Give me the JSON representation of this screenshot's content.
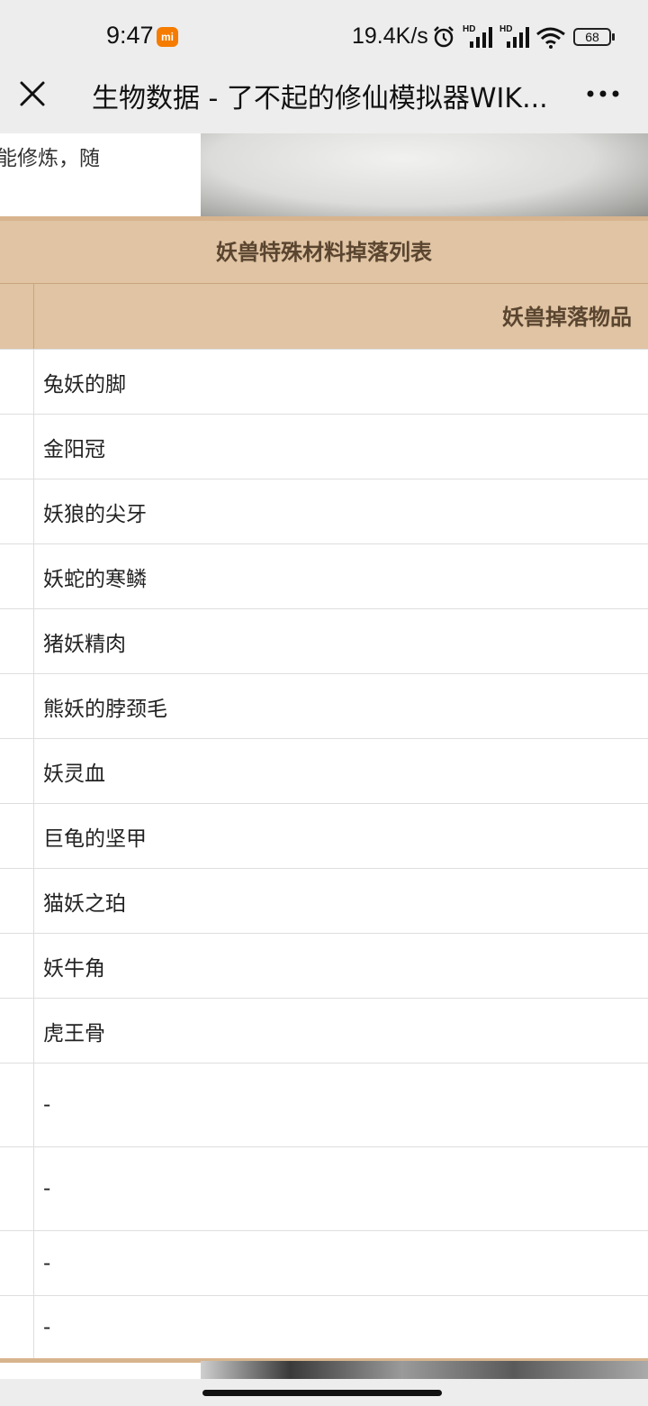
{
  "status_bar": {
    "time": "9:47",
    "mi_badge": "mi",
    "net_speed": "19.4K/s",
    "signal_label_1": "HD",
    "signal_label_2": "HD",
    "battery": "68",
    "icons": [
      "alarm-icon",
      "signal-icon",
      "signal-icon",
      "wifi-icon",
      "battery-icon"
    ]
  },
  "title_bar": {
    "title": "生物数据 - 了不起的修仙模拟器WIK...",
    "icons": [
      "close-icon",
      "more-icon"
    ]
  },
  "intro": {
    "text": "能修炼，随"
  },
  "table": {
    "caption": "妖兽特殊材料掉落列表",
    "header": "妖兽掉落物品",
    "rows": [
      "兔妖的脚",
      "金阳冠",
      "妖狼的尖牙",
      "妖蛇的寒鳞",
      "猪妖精肉",
      "熊妖的脖颈毛",
      "妖灵血",
      "巨龟的坚甲",
      "猫妖之珀",
      "妖牛角",
      "虎王骨",
      "-",
      "-",
      "-",
      "-"
    ]
  },
  "colors": {
    "table_header_bg": "#e0c4a3",
    "table_border": "#d7b48e",
    "header_text": "#5a4530",
    "chrome_bg": "#ededed",
    "mi_badge": "#f57c00"
  }
}
